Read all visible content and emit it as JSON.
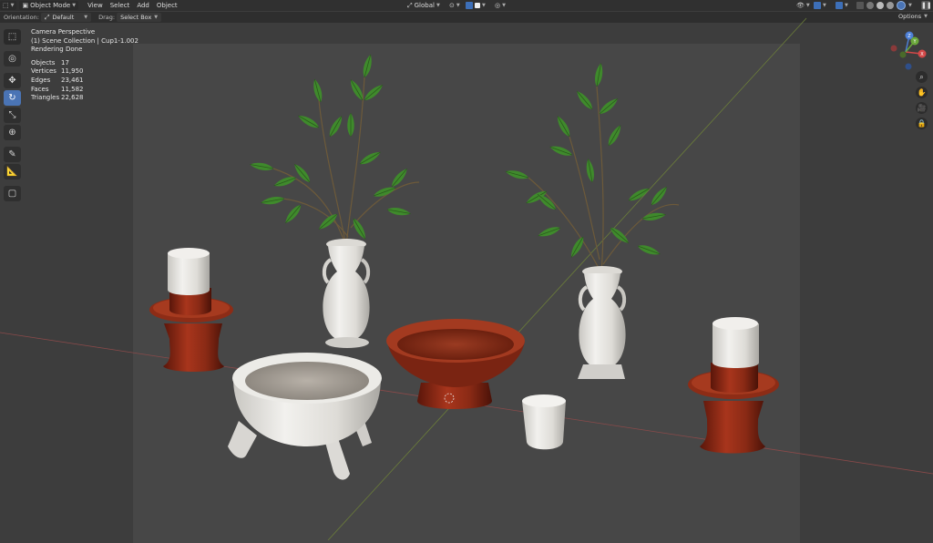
{
  "header": {
    "editor_icon": "3d-viewport-icon",
    "mode": "Object Mode",
    "menus": [
      "View",
      "Select",
      "Add",
      "Object"
    ],
    "transform_space": "Global",
    "accent": "#4a74b5"
  },
  "toolbar2": {
    "orientation_label": "Orientation:",
    "orientation_value": "Default",
    "drag_label": "Drag:",
    "drag_value": "Select Box",
    "options_label": "Options"
  },
  "stats": {
    "line1": "Camera Perspective",
    "line2": "(1) Scene Collection | Cup1-1.002",
    "line3": "Rendering Done",
    "rows": [
      {
        "k": "Objects",
        "v": "17"
      },
      {
        "k": "Vertices",
        "v": "11,950"
      },
      {
        "k": "Edges",
        "v": "23,461"
      },
      {
        "k": "Faces",
        "v": "11,582"
      },
      {
        "k": "Triangles",
        "v": "22,628"
      }
    ]
  },
  "tools": [
    "select-box",
    "cursor",
    "move",
    "rotate",
    "scale",
    "transform",
    "annotate",
    "measure",
    "add-cube"
  ],
  "active_tool": "rotate",
  "gizmo": {
    "x": "X",
    "y": "Y",
    "z": "Z"
  },
  "nav_buttons": [
    "zoom-icon",
    "pan-hand-icon",
    "camera-icon",
    "lock-icon"
  ]
}
